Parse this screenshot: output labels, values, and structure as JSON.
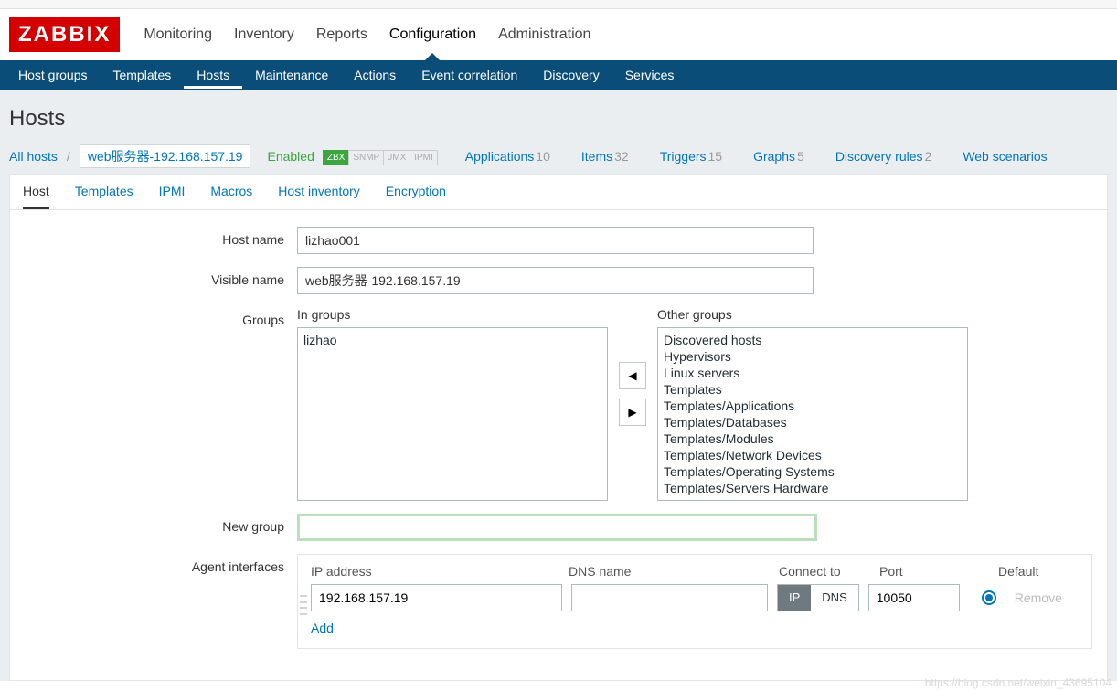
{
  "logo": "ZABBIX",
  "topnav": {
    "monitoring": "Monitoring",
    "inventory": "Inventory",
    "reports": "Reports",
    "configuration": "Configuration",
    "administration": "Administration"
  },
  "subnav": {
    "host_groups": "Host groups",
    "templates": "Templates",
    "hosts": "Hosts",
    "maintenance": "Maintenance",
    "actions": "Actions",
    "event_correlation": "Event correlation",
    "discovery": "Discovery",
    "services": "Services"
  },
  "page_title": "Hosts",
  "breadcrumb": {
    "all_hosts": "All hosts",
    "current_host": "web服务器-192.168.157.19",
    "status": "Enabled",
    "tags": {
      "zbx": "ZBX",
      "snmp": "SNMP",
      "jmx": "JMX",
      "ipmi": "IPMI"
    },
    "stats": {
      "applications": {
        "label": "Applications",
        "count": "10"
      },
      "items": {
        "label": "Items",
        "count": "32"
      },
      "triggers": {
        "label": "Triggers",
        "count": "15"
      },
      "graphs": {
        "label": "Graphs",
        "count": "5"
      },
      "discovery": {
        "label": "Discovery rules",
        "count": "2"
      },
      "web": {
        "label": "Web scenarios",
        "count": ""
      }
    }
  },
  "tabs": {
    "host": "Host",
    "templates": "Templates",
    "ipmi": "IPMI",
    "macros": "Macros",
    "inventory": "Host inventory",
    "encryption": "Encryption"
  },
  "form": {
    "host_name_label": "Host name",
    "host_name_value": "lizhao001",
    "visible_name_label": "Visible name",
    "visible_name_value": "web服务器-192.168.157.19",
    "groups_label": "Groups",
    "in_groups_label": "In groups",
    "other_groups_label": "Other groups",
    "in_groups": [
      "lizhao"
    ],
    "other_groups": [
      "Discovered hosts",
      "Hypervisors",
      "Linux servers",
      "Templates",
      "Templates/Applications",
      "Templates/Databases",
      "Templates/Modules",
      "Templates/Network Devices",
      "Templates/Operating Systems",
      "Templates/Servers Hardware"
    ],
    "new_group_label": "New group",
    "new_group_value": "",
    "agent_interfaces_label": "Agent interfaces",
    "iface": {
      "ip_label": "IP address",
      "dns_label": "DNS name",
      "connect_label": "Connect to",
      "port_label": "Port",
      "default_label": "Default",
      "ip_value": "192.168.157.19",
      "dns_value": "",
      "connect_ip": "IP",
      "connect_dns": "DNS",
      "port_value": "10050",
      "remove": "Remove",
      "add": "Add"
    }
  },
  "watermark": "https://blog.csdn.net/weixin_43695104"
}
